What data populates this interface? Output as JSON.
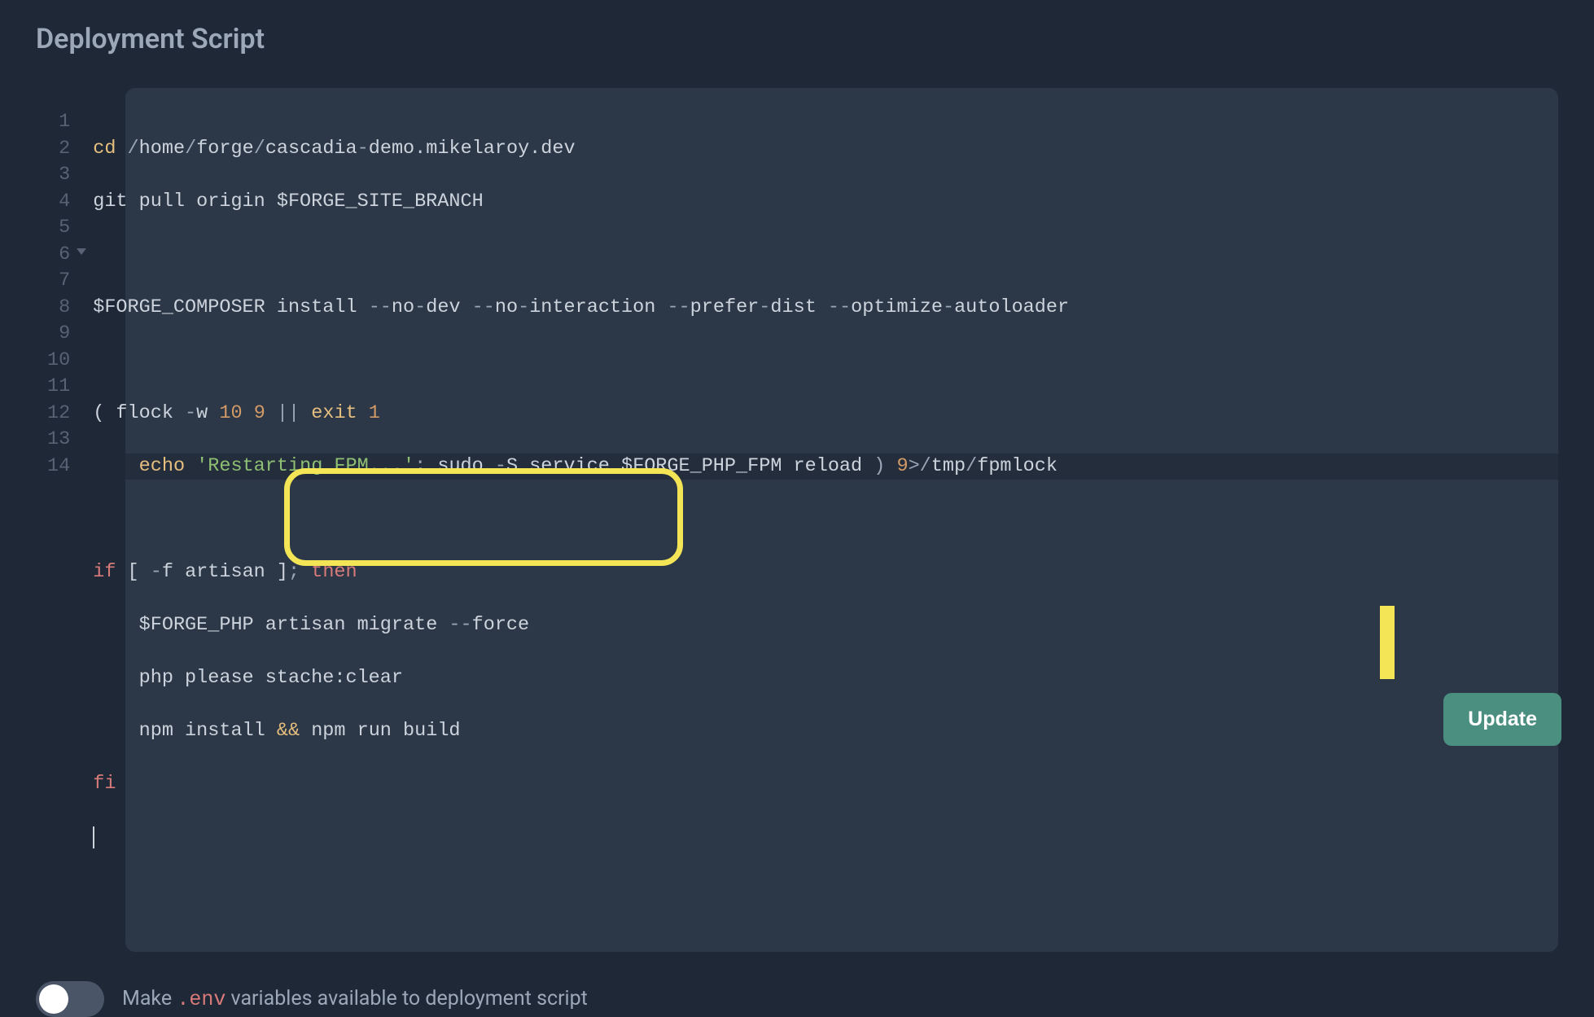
{
  "header": {
    "title": "Deployment Script"
  },
  "editor": {
    "line_count": 14,
    "fold_line": 6,
    "active_line": 14,
    "lines": {
      "l1": {
        "cd": "cd",
        "sl": "/",
        "p1": "home",
        "p2": "forge",
        "p3": "cascadia",
        "dash": "-",
        "p4": "demo.mikelaroy.dev"
      },
      "l2": {
        "t": "git pull origin $FORGE_SITE_BRANCH"
      },
      "l3": {
        "t": ""
      },
      "l4": {
        "t": "$FORGE_COMPOSER install ",
        "d1": "--",
        "a1": "no",
        "h": "-",
        "a2": "dev ",
        "d2": "--",
        "a3": "no",
        "a4": "interaction ",
        "d3": "--",
        "a5": "prefer",
        "a6": "dist ",
        "d4": "--",
        "a7": "optimize",
        "a8": "autoloader"
      },
      "l5": {
        "t": ""
      },
      "l6": {
        "open": "( flock ",
        "d": "-",
        "w": "w ",
        "n1": "10",
        "sp": " ",
        "n2": "9",
        "or": " || ",
        "ex": "exit",
        "sp2": " ",
        "n3": "1"
      },
      "l7": {
        "pad": "    ",
        "echo": "echo",
        "sp": " ",
        "str": "'Restarting FPM...'",
        "semi": ";",
        "rest": " sudo ",
        "d": "-",
        "S": "S service $FORGE_PHP_FPM reload ",
        "close": ")",
        "sp2": " ",
        "n": "9",
        "gt": ">/",
        "p1": "tmp",
        "sl": "/",
        "p2": "fpmlock"
      },
      "l8": {
        "t": ""
      },
      "l9": {
        "if": "if",
        "br": " [ ",
        "d": "-",
        "f": "f artisan ]",
        "semi": ";",
        "sp": " ",
        "then": "then"
      },
      "l10": {
        "pad": "    ",
        "t": "$FORGE_PHP artisan migrate ",
        "dd": "--",
        "force": "force"
      },
      "l11": {
        "pad": "    ",
        "t": "php please stache:clear"
      },
      "l12": {
        "pad": "    ",
        "t1": "npm install ",
        "amp": "&&",
        "t2": " npm run build"
      },
      "l13": {
        "fi": "fi"
      },
      "l14": {
        "t": ""
      }
    }
  },
  "toggle": {
    "state": "off",
    "label_pre": "Make ",
    "env": ".env",
    "label_post": " variables available to deployment script"
  },
  "actions": {
    "update_label": "Update"
  }
}
